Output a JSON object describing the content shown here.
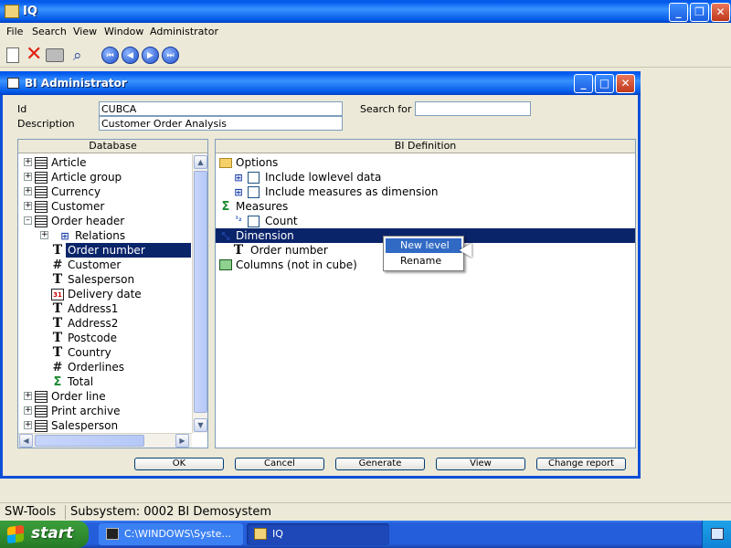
{
  "app": {
    "title": "IQ"
  },
  "menu": [
    "File",
    "Search",
    "View",
    "Window",
    "Administrator"
  ],
  "toolbar_icons": [
    "new-document-icon",
    "delete-icon",
    "print-icon",
    "find-icon",
    "first-record-icon",
    "previous-record-icon",
    "next-record-icon",
    "last-record-icon"
  ],
  "bi_window": {
    "title": "BI Administrator",
    "id_label": "Id",
    "id_value": "CUBCA",
    "description_label": "Description",
    "description_value": "Customer Order Analysis",
    "search_label": "Search for",
    "search_value": ""
  },
  "database": {
    "header": "Database",
    "items": [
      {
        "label": "Article",
        "icon": "table-icon",
        "expander": "+"
      },
      {
        "label": "Article group",
        "icon": "table-icon",
        "expander": "+"
      },
      {
        "label": "Currency",
        "icon": "table-icon",
        "expander": "+"
      },
      {
        "label": "Customer",
        "icon": "table-icon",
        "expander": "+"
      },
      {
        "label": "Order header",
        "icon": "table-icon",
        "expander": "-"
      },
      {
        "label": "Relations",
        "icon": "relations-icon",
        "expander": "+"
      },
      {
        "label": "Order number",
        "icon": "text-field-icon",
        "selected": true
      },
      {
        "label": "Customer",
        "icon": "number-field-icon"
      },
      {
        "label": "Salesperson",
        "icon": "text-field-icon"
      },
      {
        "label": "Delivery date",
        "icon": "date-field-icon"
      },
      {
        "label": "Address1",
        "icon": "text-field-icon"
      },
      {
        "label": "Address2",
        "icon": "text-field-icon"
      },
      {
        "label": "Postcode",
        "icon": "text-field-icon"
      },
      {
        "label": "Country",
        "icon": "text-field-icon"
      },
      {
        "label": "Orderlines",
        "icon": "number-field-icon"
      },
      {
        "label": "Total",
        "icon": "sum-icon"
      },
      {
        "label": "Order line",
        "icon": "table-icon",
        "expander": "+"
      },
      {
        "label": "Print archive",
        "icon": "table-icon",
        "expander": "+"
      },
      {
        "label": "Salesperson",
        "icon": "table-icon",
        "expander": "+"
      }
    ]
  },
  "bi_definition": {
    "header": "BI Definition",
    "items": [
      {
        "label": "Options",
        "icon": "folder-open-icon"
      },
      {
        "label": "Include lowlevel data",
        "icon": "option-icon",
        "checked": false
      },
      {
        "label": "Include measures as dimension",
        "icon": "option-icon",
        "checked": false
      },
      {
        "label": "Measures",
        "icon": "sum-icon"
      },
      {
        "label": "Count",
        "icon": "count-icon",
        "checked": false
      },
      {
        "label": "Dimension",
        "icon": "dimension-icon",
        "selected": true
      },
      {
        "label": "Order number",
        "icon": "text-field-icon"
      },
      {
        "label": "Columns (not in cube)",
        "icon": "columns-icon"
      }
    ]
  },
  "context_menu": {
    "items": [
      "New level",
      "Rename"
    ]
  },
  "buttons": {
    "ok": "OK",
    "cancel": "Cancel",
    "generate": "Generate",
    "view": "View",
    "change_report": "Change report"
  },
  "status": {
    "left": "SW-Tools",
    "subsystem": "Subsystem: 0002 BI Demosystem"
  },
  "taskbar": {
    "start": "start",
    "tasks": [
      "C:\\WINDOWS\\Syste...",
      "IQ"
    ]
  }
}
